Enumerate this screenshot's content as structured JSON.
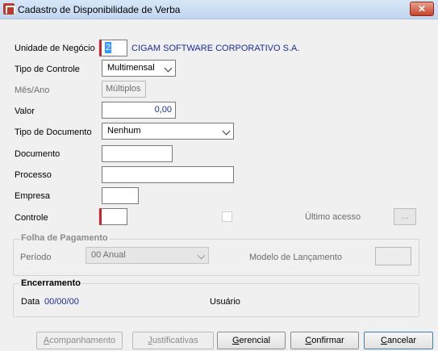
{
  "window": {
    "title": "Cadastro de Disponibilidade de Verba",
    "close_glyph": "✕"
  },
  "form": {
    "unidade": {
      "label": "Unidade de Negócio",
      "code": "2",
      "name": "CIGAM SOFTWARE CORPORATIVO S.A."
    },
    "tipo_controle": {
      "label": "Tipo de Controle",
      "value": "Multimensal"
    },
    "mes_ano": {
      "label": "Mês/Ano",
      "value": "Múltiplos"
    },
    "valor": {
      "label": "Valor",
      "value": "0,00"
    },
    "tipo_documento": {
      "label": "Tipo de Documento",
      "value": "Nenhum"
    },
    "documento": {
      "label": "Documento",
      "value": ""
    },
    "processo": {
      "label": "Processo",
      "value": ""
    },
    "empresa": {
      "label": "Empresa",
      "value": ""
    },
    "controle": {
      "label": "Controle",
      "value": ""
    },
    "ultimo_acesso": {
      "label": "Último acesso",
      "button": "..."
    }
  },
  "folha": {
    "title": "Folha de Pagamento",
    "periodo_label": "Período",
    "periodo_value": "00 Anual",
    "modelo_label": "Modelo de Lançamento"
  },
  "encerramento": {
    "title": "Encerramento",
    "data_label": "Data",
    "data_value": "00/00/00",
    "usuario_label": "Usuário"
  },
  "buttons": {
    "acompanhamento": {
      "first": "A",
      "rest": "companhamento"
    },
    "justificativas": {
      "first": "J",
      "rest": "ustificativas"
    },
    "gerencial": {
      "first": "G",
      "rest": "erencial"
    },
    "confirmar": {
      "first": "C",
      "rest": "onfirmar"
    },
    "cancelar": {
      "first": "C",
      "rest": "ancelar"
    }
  }
}
